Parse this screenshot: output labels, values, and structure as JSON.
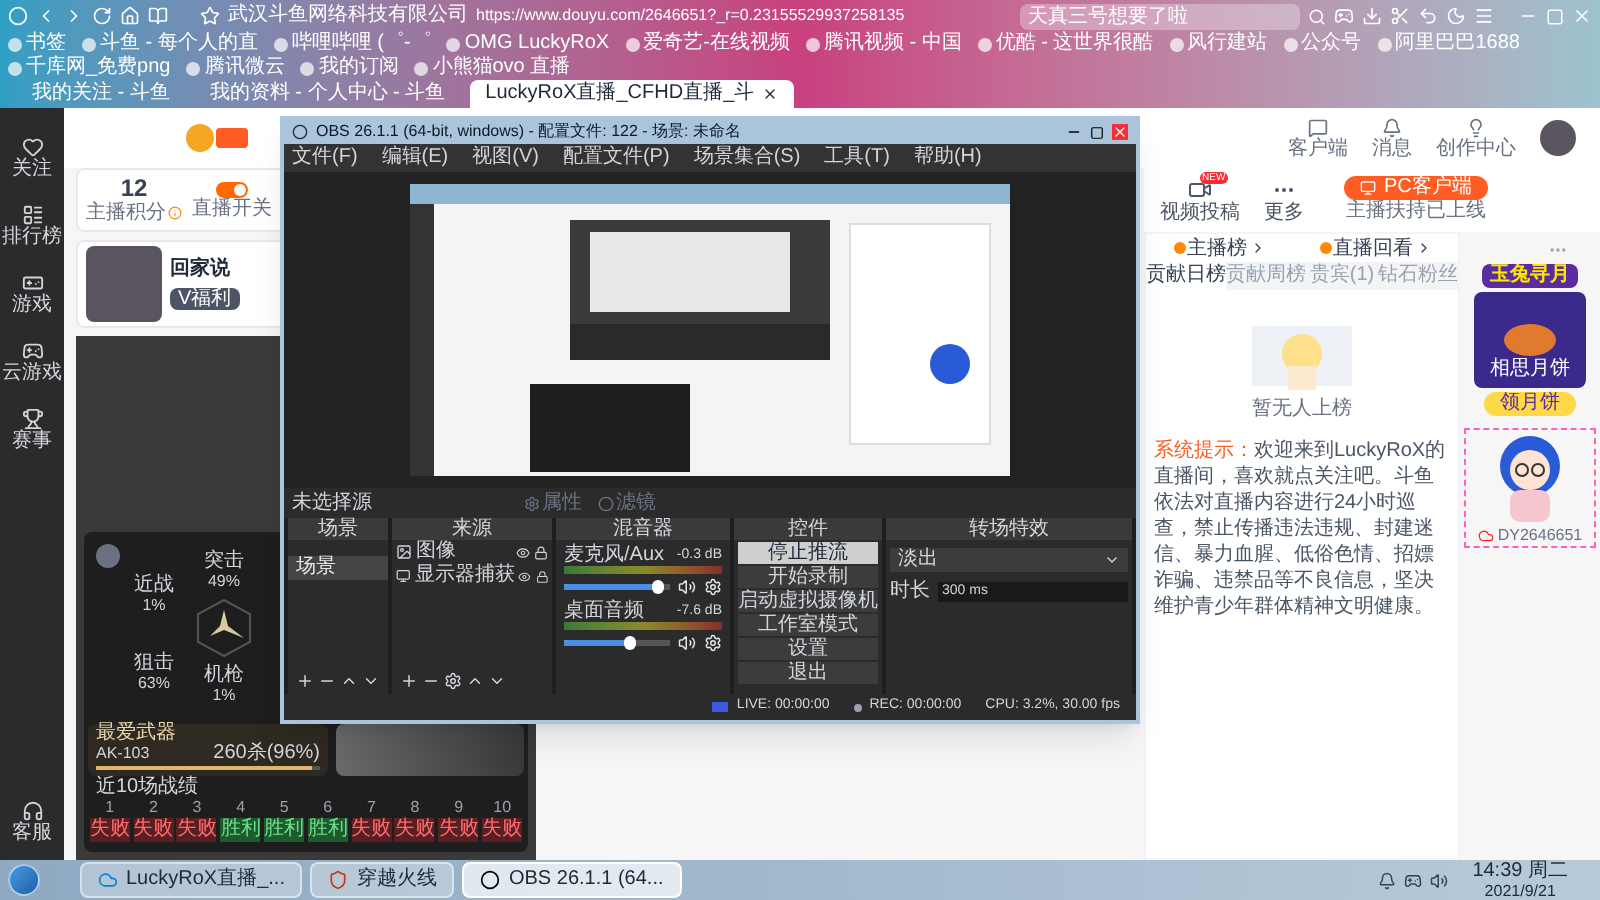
{
  "browser": {
    "site_name": "武汉斗鱼网络科技有限公司",
    "url": "https://www.douyu.com/2646651?_r=0.23155529937258135",
    "search": "天真三号想要了啦",
    "bookmarks": [
      "书签",
      "斗鱼 - 每个人的直",
      "哔哩哔哩 (゜-゜",
      "OMG LuckyRoX",
      "爱奇艺-在线视频",
      "腾讯视频 - 中国",
      "优酷 - 这世界很酷",
      "风行建站",
      "公众号",
      "阿里巴巴1688",
      "千库网_免费png",
      "腾讯微云",
      "我的订阅",
      "小熊猫ovo 直播"
    ],
    "tabs": [
      {
        "label": "我的关注 - 斗鱼",
        "selected": false
      },
      {
        "label": "我的资料 - 个人中心 - 斗鱼",
        "selected": false
      },
      {
        "label": "LuckyRoX直播_CFHD直播_斗",
        "selected": true
      }
    ]
  },
  "sidebar": {
    "items": [
      "关注",
      "排行榜",
      "游戏",
      "云游戏",
      "赛事"
    ],
    "footer": "客服"
  },
  "header_links": [
    "客户端",
    "消息",
    "创作中心"
  ],
  "anchor_stats": {
    "score": "12",
    "score_label": "主播积分",
    "toggle_label": "直播开关"
  },
  "anchor": {
    "name": "回家说",
    "tag": "V福利"
  },
  "quick_links": [
    {
      "label": "视频投稿",
      "badge": "NEW"
    },
    {
      "label": "更多"
    }
  ],
  "pc_client": {
    "button": "PC客户端",
    "note": "主播扶持已上线"
  },
  "rank_panel": {
    "links": [
      "主播榜",
      "直播回看"
    ],
    "tabs": [
      {
        "label": "贡献日榜",
        "selected": true
      },
      {
        "label": "贡献周榜",
        "selected": false
      },
      {
        "label": "贵宾(1)",
        "selected": false
      },
      {
        "label": "钻石粉丝",
        "selected": false
      }
    ],
    "empty_text": "暂无人上榜",
    "notice_label": "系统提示：",
    "notice_text": "欢迎来到LuckyRoX的直播间，喜欢就点关注吧。斗鱼依法对直播内容进行24小时巡查，禁止传播违法违规、封建迷信、暴力血腥、低俗色情、招嫖诈骗、违禁品等不良信息，坚决维护青少年群体精神文明健康。"
  },
  "promo": {
    "title": "玉兔寻月",
    "item": "相思月饼",
    "button": "领月饼"
  },
  "overlay": {
    "room_id": "DY2646651"
  },
  "game_stats": {
    "radar": [
      {
        "label": "近战",
        "value": "1%"
      },
      {
        "label": "狙击",
        "value": "63%"
      },
      {
        "label": "突击",
        "value": "49%"
      },
      {
        "label": "机枪",
        "value": "1%"
      }
    ],
    "weapon": {
      "title": "最爱武器",
      "name": "AK-103",
      "kills": "260杀(96%)",
      "level": 0.96
    },
    "record_title": "近10场战绩",
    "record": [
      {
        "match": "1",
        "result": "失败",
        "win": false
      },
      {
        "match": "2",
        "result": "失败",
        "win": false
      },
      {
        "match": "3",
        "result": "失败",
        "win": false
      },
      {
        "match": "4",
        "result": "胜利",
        "win": true
      },
      {
        "match": "5",
        "result": "胜利",
        "win": true
      },
      {
        "match": "6",
        "result": "胜利",
        "win": true
      },
      {
        "match": "7",
        "result": "失败",
        "win": false
      },
      {
        "match": "8",
        "result": "失败",
        "win": false
      },
      {
        "match": "9",
        "result": "失败",
        "win": false
      },
      {
        "match": "10",
        "result": "失败",
        "win": false
      }
    ]
  },
  "obs": {
    "title": "OBS 26.1.1 (64-bit, windows) - 配置文件: 122 - 场景: 未命名",
    "menu": [
      "文件(F)",
      "编辑(E)",
      "视图(V)",
      "配置文件(P)",
      "场景集合(S)",
      "工具(T)",
      "帮助(H)"
    ],
    "source_bar": {
      "label": "未选择源",
      "buttons": [
        "属性",
        "滤镜"
      ]
    },
    "scenes": {
      "title": "场景",
      "items": [
        {
          "label": "场景",
          "selected": true
        }
      ]
    },
    "sources": {
      "title": "来源",
      "items": [
        {
          "label": "图像",
          "kind": "image"
        },
        {
          "label": "显示器捕获",
          "kind": "display"
        }
      ]
    },
    "mixer": {
      "title": "混音器",
      "channels": [
        {
          "name": "麦克风/Aux",
          "reading": "-0.3 dB",
          "level": 0.88
        },
        {
          "name": "桌面音频",
          "reading": "-7.6 dB",
          "level": 0.62
        }
      ]
    },
    "controls": {
      "title": "控件",
      "buttons": [
        {
          "label": "停止推流",
          "active": true
        },
        {
          "label": "开始录制",
          "active": false
        },
        {
          "label": "启动虚拟摄像机",
          "active": false
        },
        {
          "label": "工作室模式",
          "active": false
        },
        {
          "label": "设置",
          "active": false
        },
        {
          "label": "退出",
          "active": false
        }
      ]
    },
    "transitions": {
      "title": "转场特效",
      "select": "淡出",
      "duration_label": "时长",
      "duration": "300 ms"
    },
    "status": {
      "live": "LIVE: 00:00:00",
      "rec": "REC: 00:00:00",
      "cpu": "CPU: 3.2%, 30.00 fps"
    }
  },
  "taskbar": {
    "buttons": [
      {
        "label": "LuckyRoX直播_...",
        "selected": false
      },
      {
        "label": "穿越火线",
        "selected": false
      },
      {
        "label": "OBS 26.1.1 (64...",
        "selected": true
      }
    ],
    "time": "14:39 周二",
    "date": "2021/9/21"
  }
}
